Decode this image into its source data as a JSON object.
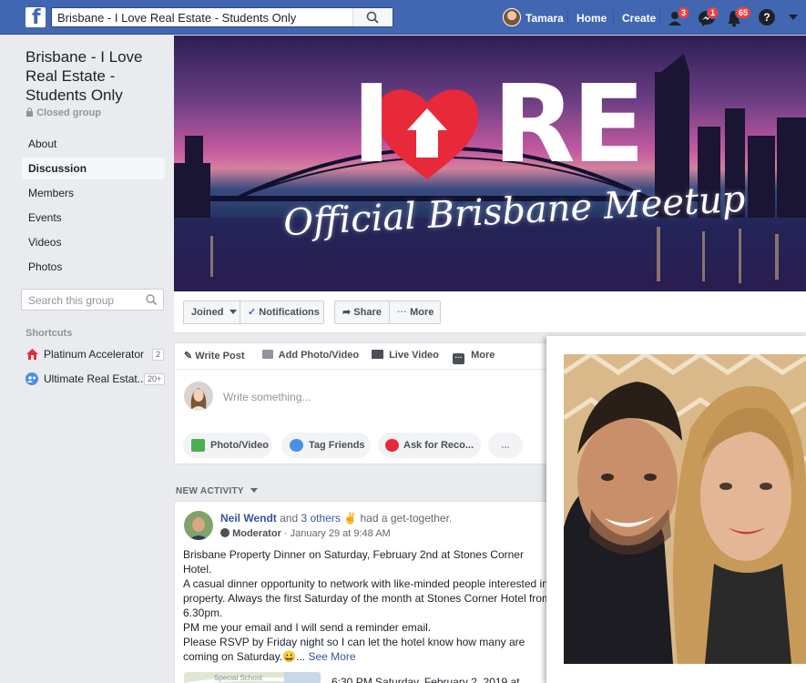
{
  "topbar": {
    "search_value": "Brisbane - I Love Real Estate - Students Only",
    "user_name": "Tamara",
    "home_label": "Home",
    "create_label": "Create",
    "friend_requests_count": "3",
    "messages_count": "1",
    "notifications_count": "65",
    "help_glyph": "?"
  },
  "group": {
    "title": "Brisbane - I Love Real Estate - Students Only",
    "privacy": "Closed group",
    "nav": [
      "About",
      "Discussion",
      "Members",
      "Events",
      "Videos",
      "Photos"
    ],
    "active_nav": "Discussion",
    "search_placeholder": "Search this group",
    "shortcuts_label": "Shortcuts",
    "shortcuts": [
      {
        "label": "Platinum Accelerator",
        "count": "2"
      },
      {
        "label": "Ultimate Real Estat...",
        "count": "20+"
      }
    ]
  },
  "cover": {
    "logo_left": "I",
    "logo_right": "RE",
    "script_text": "Official Brisbane Meetup"
  },
  "cover_actions": {
    "joined": "Joined",
    "notifications": "Notifications",
    "share": "Share",
    "more": "More"
  },
  "composer": {
    "tabs": [
      "Write Post",
      "Add Photo/Video",
      "Live Video",
      "More"
    ],
    "placeholder": "Write something...",
    "pills": [
      "Photo/Video",
      "Tag Friends",
      "Ask for Reco...",
      "..."
    ]
  },
  "activity": {
    "label": "NEW ACTIVITY",
    "post": {
      "author": "Neil Wendt",
      "joiner": "and",
      "others": "3 others",
      "action": "had a get-together.",
      "role": "Moderator",
      "timestamp": "January 29 at 9:48 AM",
      "lines": [
        "Brisbane Property Dinner on Saturday, February 2nd at Stones Corner",
        "Hotel.",
        "A casual dinner opportunity to network with like-minded people interested in",
        "property. Always the first Saturday of the month at Stones Corner Hotel from",
        "6.30pm.",
        "PM me your email and I will send a reminder email.",
        "Please RSVP by Friday night so I can let the hotel know how many are",
        "coming on Saturday."
      ],
      "emoji": "😀",
      "ellipsis": "...",
      "see_more": "See More",
      "event_line": "6:30 PM Saturday, February 2, 2019 at",
      "map_label": "Special School"
    }
  },
  "colors": {
    "brand_blue": "#4267b2",
    "link_blue": "#365899",
    "badge_red": "#fa3e3e",
    "logo_red": "#e8293a"
  }
}
